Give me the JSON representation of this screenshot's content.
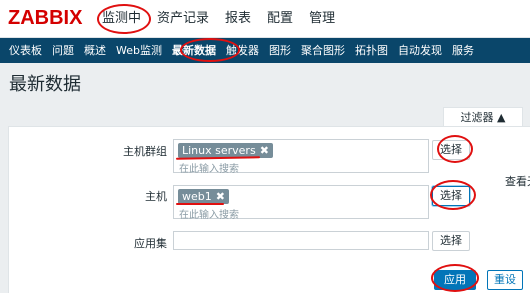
{
  "app": {
    "logo": "ZABBIX"
  },
  "main_menu": [
    {
      "label": "监测中",
      "active": true
    },
    {
      "label": "资产记录"
    },
    {
      "label": "报表"
    },
    {
      "label": "配置"
    },
    {
      "label": "管理"
    }
  ],
  "sub_menu": [
    {
      "label": "仪表板"
    },
    {
      "label": "问题"
    },
    {
      "label": "概述"
    },
    {
      "label": "Web监测"
    },
    {
      "label": "最新数据",
      "active": true
    },
    {
      "label": "触发器"
    },
    {
      "label": "图形"
    },
    {
      "label": "聚合图形"
    },
    {
      "label": "拓扑图"
    },
    {
      "label": "自动发现"
    },
    {
      "label": "服务"
    }
  ],
  "page": {
    "title": "最新数据"
  },
  "filter": {
    "tab_label": "过滤器 ▲",
    "host_groups": {
      "label": "主机群组",
      "tag": "Linux servers",
      "placeholder": "在此输入搜索",
      "button": "选择"
    },
    "hosts": {
      "label": "主机",
      "tag": "web1",
      "placeholder": "在此输入搜索",
      "button": "选择"
    },
    "application": {
      "label": "应用集",
      "value": "",
      "button": "选择"
    },
    "side_text": "查看无",
    "apply_label": "应用",
    "reset_label": "重设"
  },
  "colors": {
    "accent": "#0275b8",
    "nav_bg": "#0a466a",
    "logo": "#d40000",
    "annotation": "#e01010"
  }
}
